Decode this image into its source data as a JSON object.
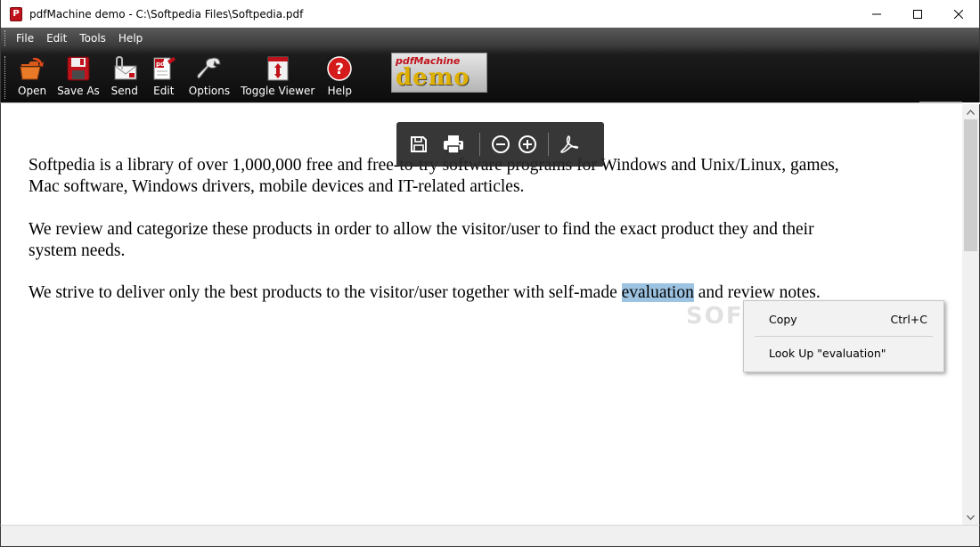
{
  "window": {
    "title": "pdfMachine demo - C:\\Softpedia Files\\Softpedia.pdf",
    "app_icon_letter": "P"
  },
  "menu": {
    "items": [
      {
        "label": "File"
      },
      {
        "label": "Edit"
      },
      {
        "label": "Tools"
      },
      {
        "label": "Help"
      }
    ]
  },
  "toolbar": {
    "buttons": [
      {
        "label": "Open",
        "icon": "open-folder-icon"
      },
      {
        "label": "Save As",
        "icon": "floppy-disk-icon"
      },
      {
        "label": "Send",
        "icon": "envelope-paperclip-icon"
      },
      {
        "label": "Edit",
        "icon": "pdf-edit-icon"
      },
      {
        "label": "Options",
        "icon": "wrench-icon"
      },
      {
        "label": "Toggle Viewer",
        "icon": "toggle-viewer-icon"
      },
      {
        "label": "Help",
        "icon": "help-circle-icon"
      }
    ],
    "demo_logo_small": "pdfMachine",
    "demo_logo_big": "demo"
  },
  "document": {
    "para1_line1": "Softpedia is a library of over 1,000,000 free and free-to-try software programs for Windows and Unix/Linux, games,",
    "para1_line2": "Mac software, Windows drivers, mobile devices and IT-related articles.",
    "para2_line1": "We review and categorize these products in order to allow the visitor/user to find the exact product they and their",
    "para2_line2": "system needs.",
    "para3_before": "We strive to deliver only the best products to the visitor/user together with self-made ",
    "para3_selected": "evaluation",
    "para3_after": " and review notes."
  },
  "floating_toolbar": {
    "buttons": [
      "save-icon",
      "print-icon",
      "zoom-out-icon",
      "zoom-in-icon",
      "acrobat-icon"
    ]
  },
  "context_menu": {
    "copy_label": "Copy",
    "copy_shortcut": "Ctrl+C",
    "lookup_label": "Look Up \"evaluation\""
  },
  "watermark": "SOFTPEDIA",
  "colors": {
    "selection": "#9dc3e2",
    "toolbar_dark": "#0c0c0c",
    "brand_red": "#c0121a"
  }
}
